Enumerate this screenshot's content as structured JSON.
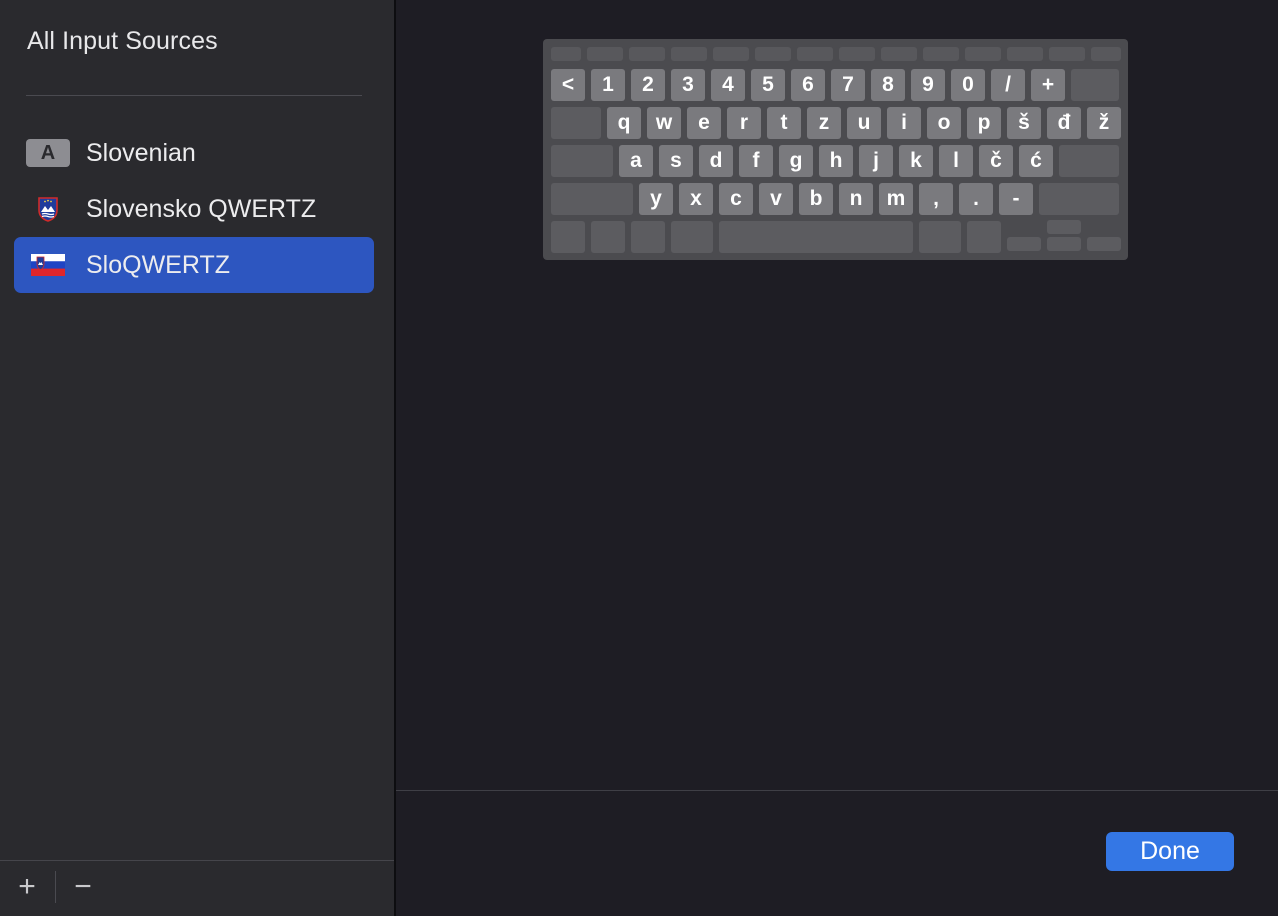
{
  "sidebar": {
    "title": "All Input Sources",
    "items": [
      {
        "label": "Slovenian",
        "icon": "letter-a-icon",
        "icon_text": "A",
        "selected": false
      },
      {
        "label": "Slovensko QWERTZ",
        "icon": "slovenia-coat-of-arms-icon",
        "selected": false
      },
      {
        "label": "SloQWERTZ",
        "icon": "slovenia-flag-icon",
        "selected": true
      }
    ],
    "add_button": "+",
    "remove_button": "−"
  },
  "keyboard": {
    "rows": [
      [
        "<",
        "1",
        "2",
        "3",
        "4",
        "5",
        "6",
        "7",
        "8",
        "9",
        "0",
        "/",
        "+"
      ],
      [
        "q",
        "w",
        "e",
        "r",
        "t",
        "z",
        "u",
        "i",
        "o",
        "p",
        "š",
        "đ",
        "ž"
      ],
      [
        "a",
        "s",
        "d",
        "f",
        "g",
        "h",
        "j",
        "k",
        "l",
        "č",
        "ć"
      ],
      [
        "y",
        "x",
        "c",
        "v",
        "b",
        "n",
        "m",
        ",",
        ".",
        "-"
      ]
    ]
  },
  "done_button": "Done",
  "colors": {
    "accent": "#3477e5",
    "selection": "#2d56c0",
    "sidebar_bg": "#2a2a2e",
    "main_bg": "#1e1d24"
  }
}
